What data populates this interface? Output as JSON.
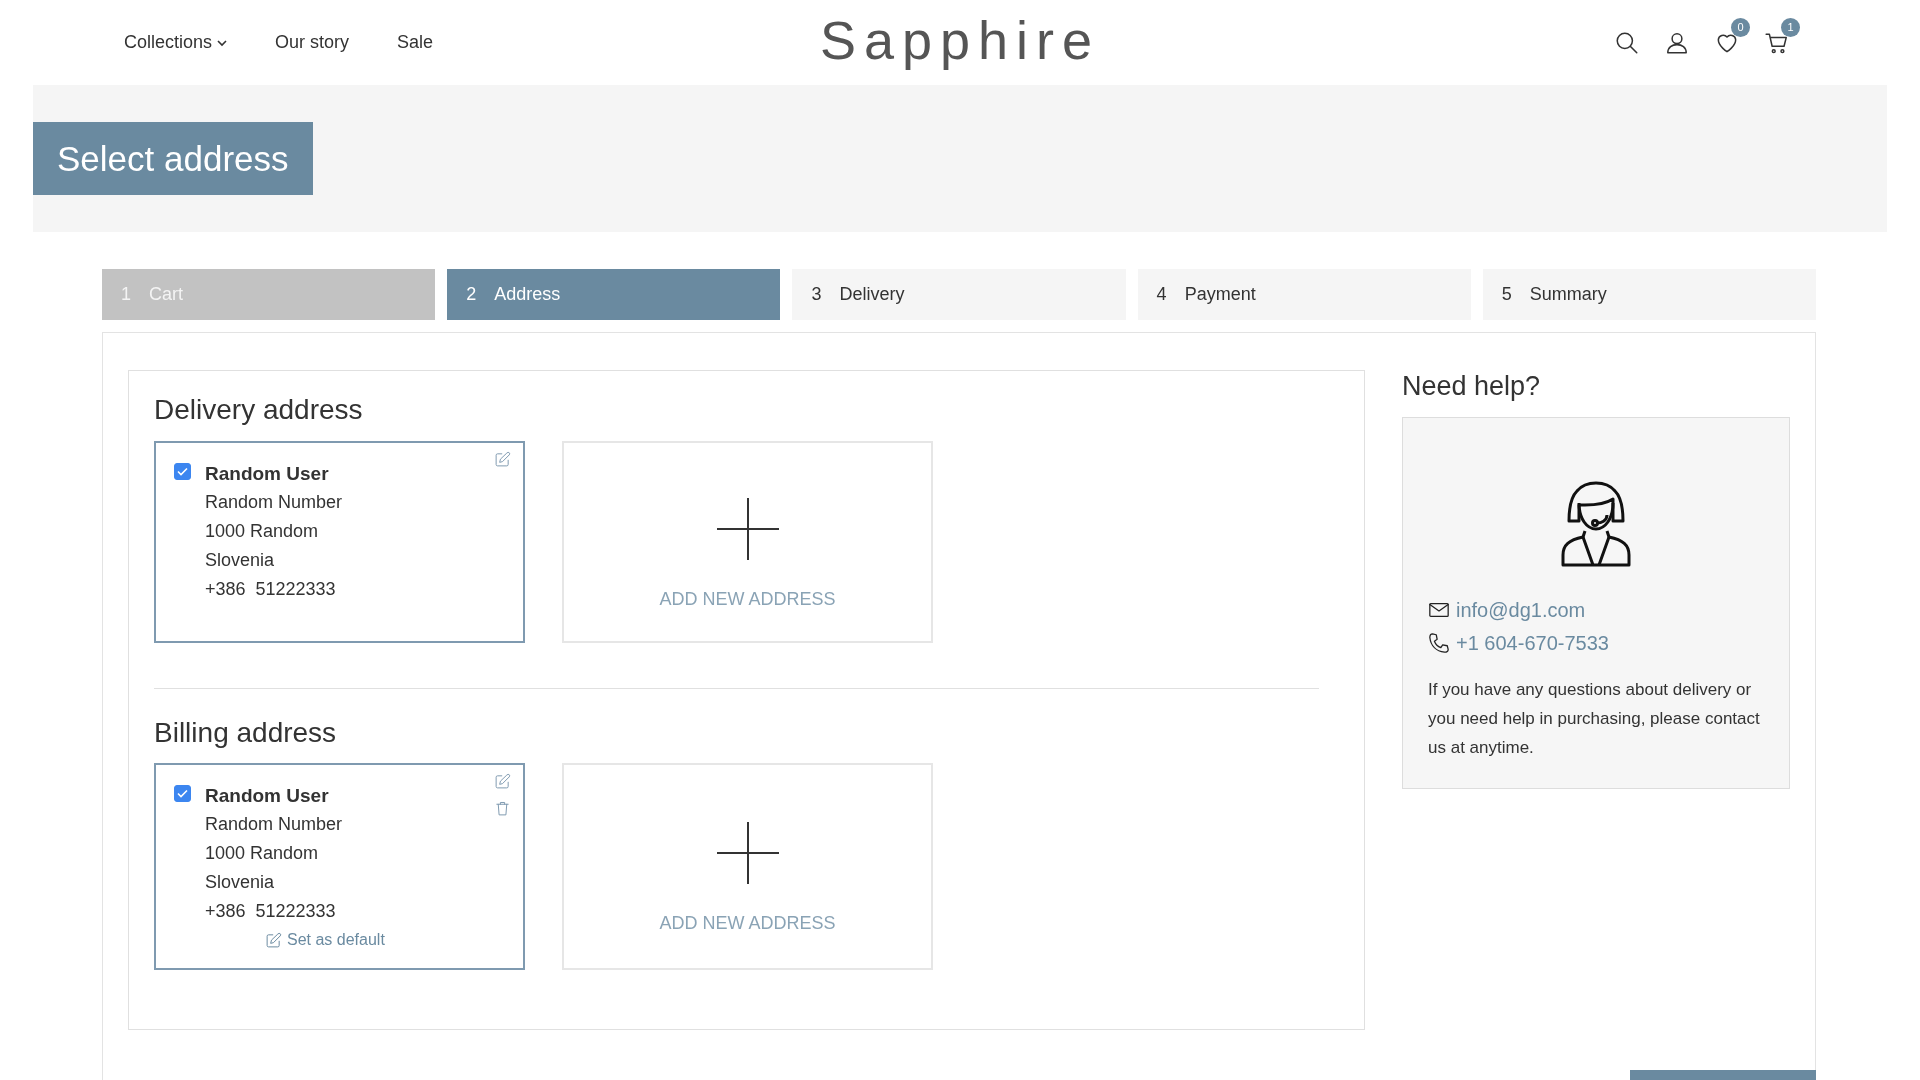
{
  "nav": {
    "menu": [
      {
        "label": "Collections",
        "dropdown": true
      },
      {
        "label": "Our story",
        "dropdown": false
      },
      {
        "label": "Sale",
        "dropdown": false
      }
    ],
    "logo": "Sapphire",
    "wishlist_count": "0",
    "cart_count": "1"
  },
  "page_title": "Select address",
  "steps": [
    {
      "number": "1",
      "label": "Cart",
      "selected": false,
      "completed": true
    },
    {
      "number": "2",
      "label": "Address",
      "selected": true,
      "completed": false
    },
    {
      "number": "3",
      "label": "Delivery",
      "selected": false,
      "completed": false
    },
    {
      "number": "4",
      "label": "Payment",
      "selected": false,
      "completed": false
    },
    {
      "number": "5",
      "label": "Summary",
      "selected": false,
      "completed": false
    }
  ],
  "sections": [
    {
      "heading": "Delivery address",
      "addresses": [
        {
          "name": "Random User",
          "lines": [
            "Random Number",
            "1000 Random",
            "Slovenia",
            "+386  51222333"
          ],
          "checked": true,
          "deletable": false
        }
      ],
      "add_label": "ADD NEW ADDRESS"
    },
    {
      "heading": "Billing address",
      "addresses": [
        {
          "name": "Random User",
          "lines": [
            "Random Number",
            "1000 Random",
            "Slovenia",
            "+386  51222333"
          ],
          "checked": true,
          "deletable": true,
          "default_action": "Set as default"
        }
      ],
      "add_label": "ADD NEW ADDRESS"
    }
  ],
  "help": {
    "heading": "Need help?",
    "email": "info@dg1.com",
    "phone": "+1 604-670-7533",
    "text": "If you have any questions about delivery or you need help in purchasing, please contact us at anytime."
  }
}
